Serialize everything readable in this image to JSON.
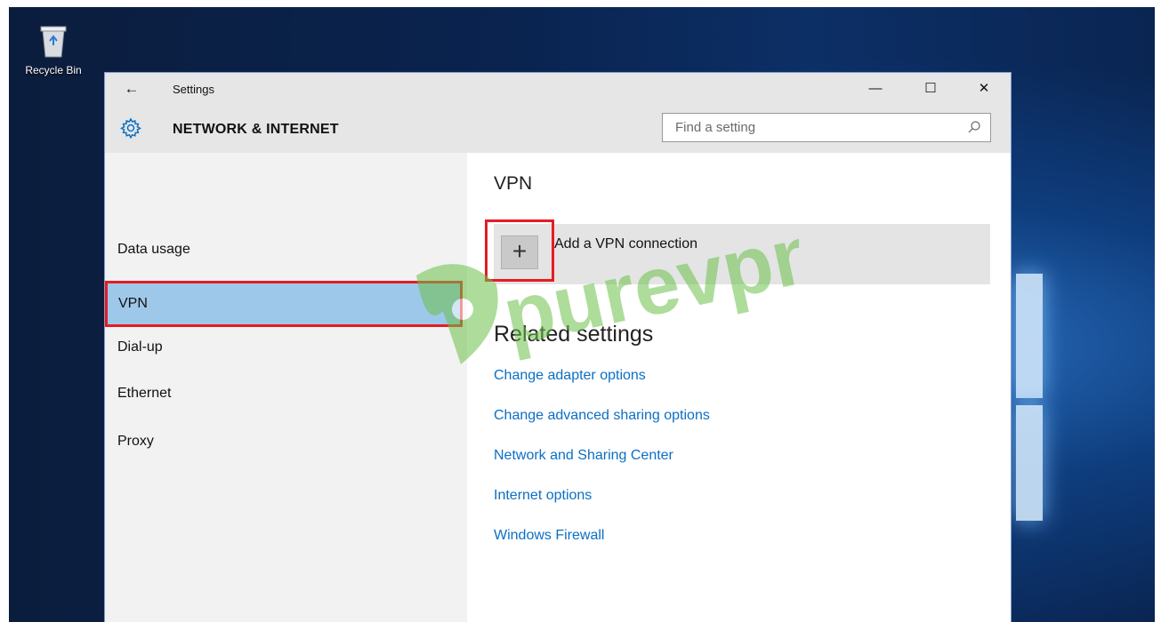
{
  "desktop": {
    "recycle_bin_label": "Recycle Bin"
  },
  "window": {
    "title": "Settings",
    "controls": {
      "minimize": "—",
      "maximize": "☐",
      "close": "✕"
    },
    "back_arrow": "←"
  },
  "header": {
    "section_title": "NETWORK & INTERNET",
    "search_placeholder": "Find a setting"
  },
  "sidebar": {
    "items": [
      {
        "label": "Data usage",
        "selected": false
      },
      {
        "label": "VPN",
        "selected": true
      },
      {
        "label": "Dial-up",
        "selected": false
      },
      {
        "label": "Ethernet",
        "selected": false
      },
      {
        "label": "Proxy",
        "selected": false
      }
    ]
  },
  "main": {
    "heading": "VPN",
    "add_vpn": {
      "plus": "+",
      "label": "Add a VPN connection"
    },
    "related_heading": "Related settings",
    "related_links": [
      "Change adapter options",
      "Change advanced sharing options",
      "Network and Sharing Center",
      "Internet options",
      "Windows Firewall"
    ]
  },
  "watermark": {
    "text": "purevpn"
  },
  "colors": {
    "accent_link": "#0b6fc4",
    "selection": "#9ec8ea",
    "highlight_box": "#e51c23",
    "watermark_green": "#6cc04a"
  },
  "icons": [
    "recycle-bin-icon",
    "back-arrow-icon",
    "gear-icon",
    "search-icon",
    "plus-icon"
  ]
}
